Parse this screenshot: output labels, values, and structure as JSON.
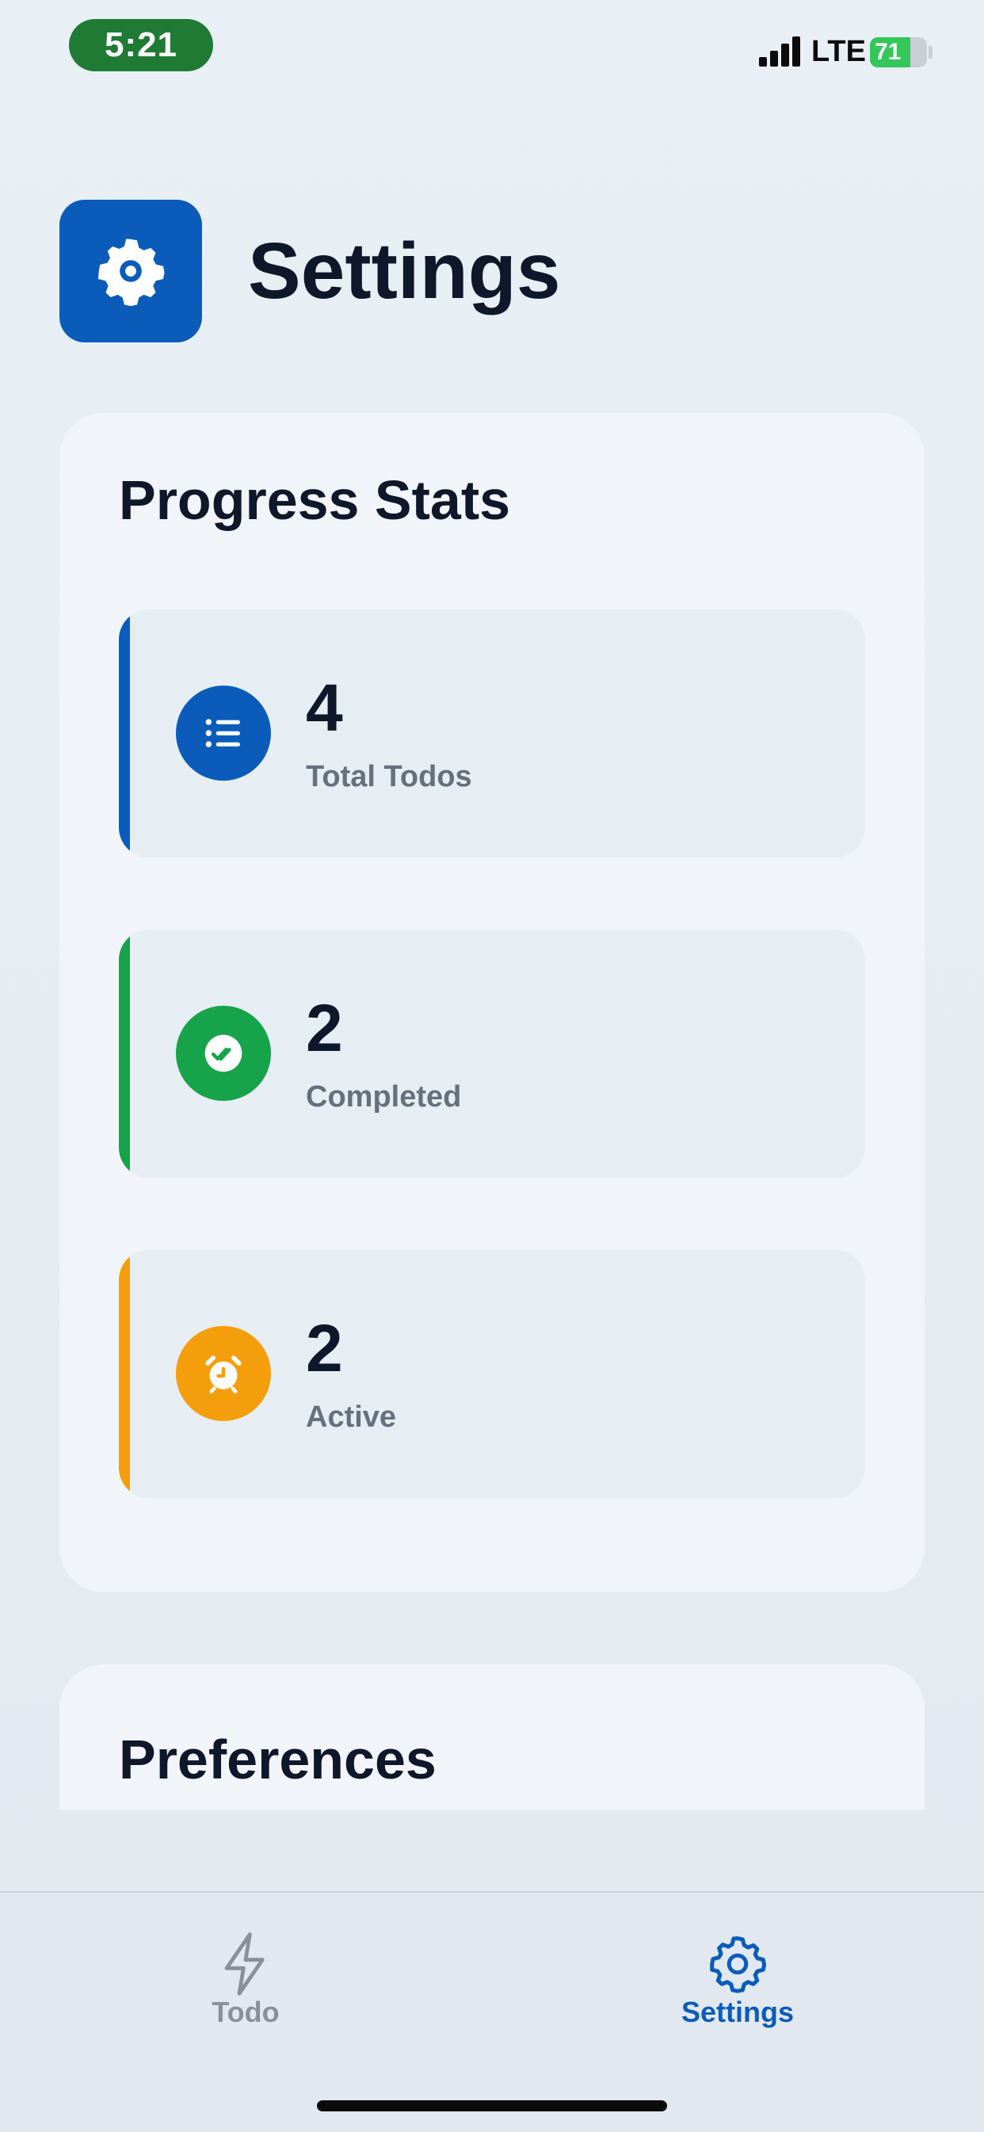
{
  "status_bar": {
    "time": "5:21",
    "network": "LTE",
    "battery_percent": "71",
    "battery_level": 0.71
  },
  "header": {
    "title": "Settings",
    "icon": "gear-icon",
    "icon_bg": "#0b5cba"
  },
  "progress": {
    "title": "Progress Stats",
    "stats": [
      {
        "value": "4",
        "label": "Total Todos",
        "icon": "list-icon",
        "color": "#0b5cba"
      },
      {
        "value": "2",
        "label": "Completed",
        "icon": "double-check-icon",
        "color": "#16a34a"
      },
      {
        "value": "2",
        "label": "Active",
        "icon": "alarm-clock-icon",
        "color": "#f59e0b"
      }
    ]
  },
  "preferences": {
    "title": "Preferences"
  },
  "tab_bar": {
    "tabs": [
      {
        "label": "Todo",
        "icon": "lightning-icon",
        "active": false,
        "color": "#8a9099"
      },
      {
        "label": "Settings",
        "icon": "gear-icon",
        "active": true,
        "color": "#0b5cba"
      }
    ]
  }
}
